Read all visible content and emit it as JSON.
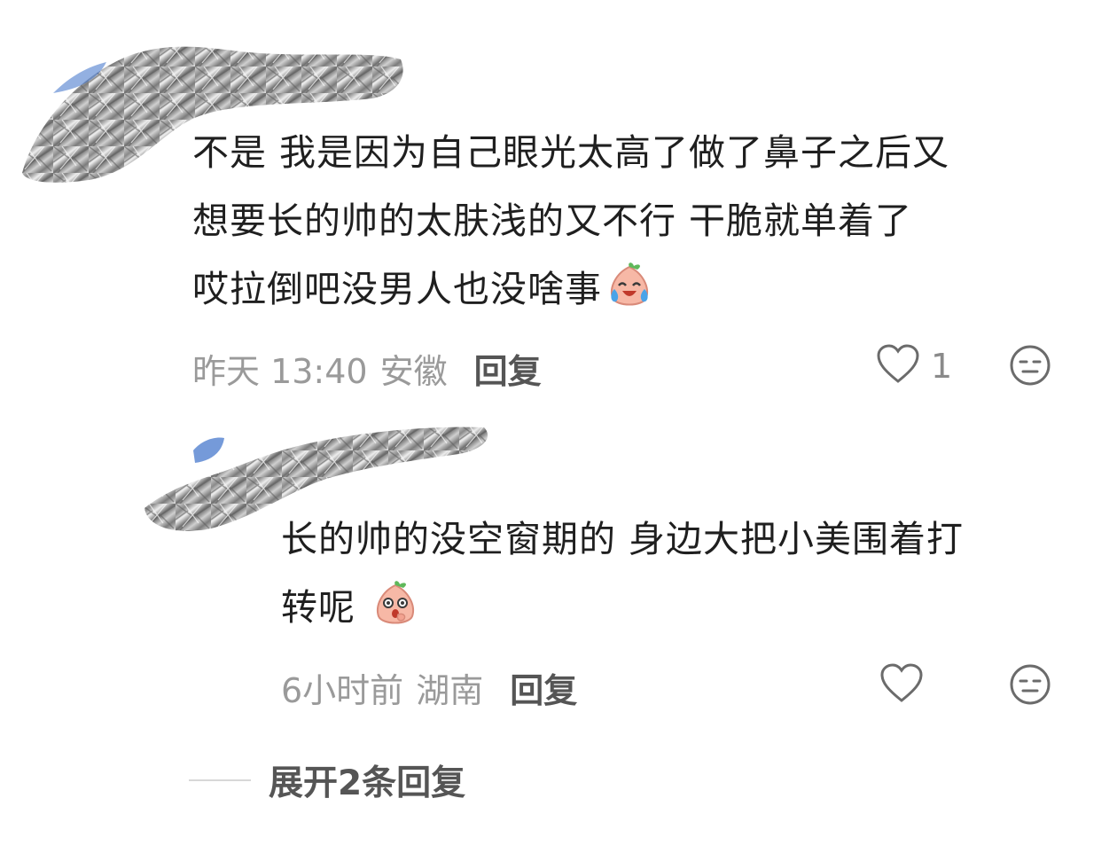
{
  "comments": [
    {
      "text_lines": [
        "不是 我是因为自己眼光太高了做了鼻子之后又",
        "想要长的帅的太肤浅的又不行 干脆就单着了",
        "哎拉倒吧没男人也没啥事"
      ],
      "time": "昨天 13:40",
      "location": "安徽",
      "reply_label": "回复",
      "like_count": "1",
      "emoji_icon": "laugh-cry-peach-icon"
    },
    {
      "text_lines": [
        "长的帅的没空窗期的 身边大把小美围着打",
        "转呢"
      ],
      "time": "6小时前",
      "location": "湖南",
      "reply_label": "回复",
      "like_count": "",
      "emoji_icon": "shocked-peach-icon"
    }
  ],
  "expand_label": "展开2条回复",
  "colors": {
    "text": "#1f1f1f",
    "meta": "#9a9a9a",
    "reply": "#555555",
    "icon": "#6b6b6b"
  }
}
